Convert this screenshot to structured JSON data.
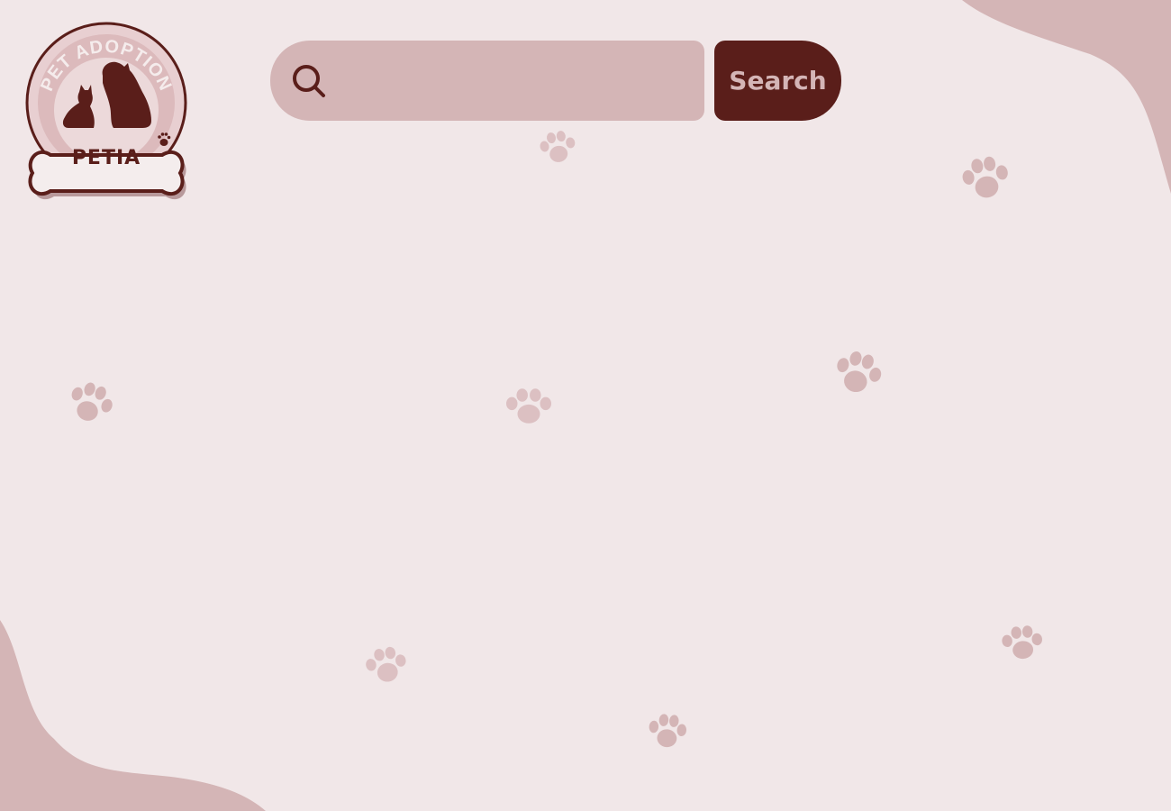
{
  "colors": {
    "background": "#f1e7e8",
    "accent": "#d4b5b6",
    "brand": "#5a1e1a"
  },
  "logo": {
    "arc_text": "PET ADOPTION",
    "name": "PETIA"
  },
  "search": {
    "placeholder": "",
    "value": "",
    "button_label": "Search",
    "icon": "search-icon"
  },
  "decorations": {
    "icon": "paw-print-icon"
  }
}
